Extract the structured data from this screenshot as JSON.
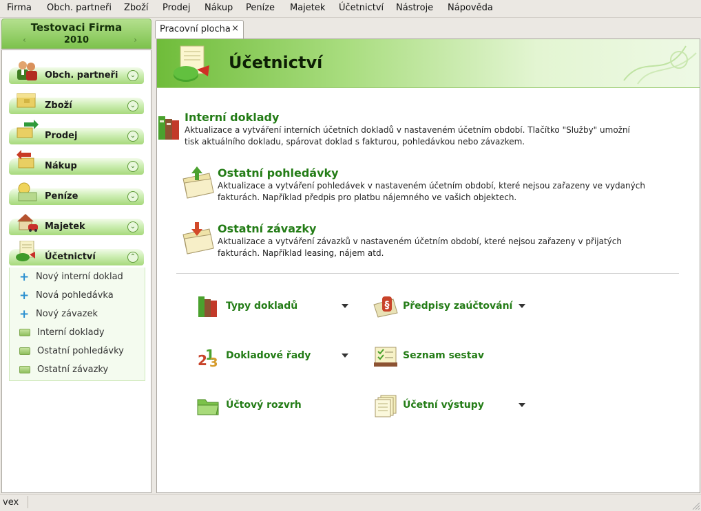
{
  "menu": [
    "Firma",
    "Obch. partneři",
    "Zboží",
    "Prodej",
    "Nákup",
    "Peníze",
    "Majetek",
    "Účetnictví",
    "Nástroje",
    "Nápověda"
  ],
  "firm": {
    "name": "Testovaci Firma",
    "year": "2010"
  },
  "sidebar": {
    "sections": [
      {
        "label": "Obch. partneři",
        "icon": "partners-icon"
      },
      {
        "label": "Zboží",
        "icon": "goods-icon"
      },
      {
        "label": "Prodej",
        "icon": "sales-icon"
      },
      {
        "label": "Nákup",
        "icon": "purchase-icon"
      },
      {
        "label": "Peníze",
        "icon": "money-icon"
      },
      {
        "label": "Majetek",
        "icon": "property-icon"
      },
      {
        "label": "Účetnictví",
        "icon": "accounting-icon"
      }
    ],
    "subitems": [
      {
        "label": "Nový interní doklad",
        "icon": "plus-icon"
      },
      {
        "label": "Nová pohledávka",
        "icon": "plus-icon"
      },
      {
        "label": "Nový závazek",
        "icon": "plus-icon"
      },
      {
        "label": "Interní doklady",
        "icon": "folder-icon"
      },
      {
        "label": "Ostatní pohledávky",
        "icon": "folder-icon"
      },
      {
        "label": "Ostatní závazky",
        "icon": "folder-icon"
      }
    ]
  },
  "tab": {
    "label": "Pracovní plocha",
    "close": "×"
  },
  "banner": {
    "title": "Účetnictví"
  },
  "items": [
    {
      "title": "Interní doklady",
      "desc": "Aktualizace a vytváření interních účetních dokladů v nastaveném účetním období. Tlačítko \"Služby\" umožní tisk aktuálního dokladu, spárovat doklad s fakturou, pohledávkou nebo závazkem."
    },
    {
      "title": "Ostatní pohledávky",
      "desc": "Aktualizace a vytváření pohledávek v nastaveném účetním období, které nejsou zařazeny ve vydaných fakturách. Například předpis pro platbu nájemného ve vašich objektech."
    },
    {
      "title": "Ostatní závazky",
      "desc": "Aktualizace a vytváření závazků v nastaveném účetním období, které nejsou zařazeny v přijatých fakturách. Například leasing, nájem atd."
    }
  ],
  "tools": [
    {
      "label": "Typy dokladů"
    },
    {
      "label": "Předpisy zaúčtování"
    },
    {
      "label": "Dokladové řady"
    },
    {
      "label": "Seznam sestav"
    },
    {
      "label": "Účtový rozvrh"
    },
    {
      "label": "Účetní výstupy"
    }
  ],
  "status": {
    "text": "vex"
  }
}
